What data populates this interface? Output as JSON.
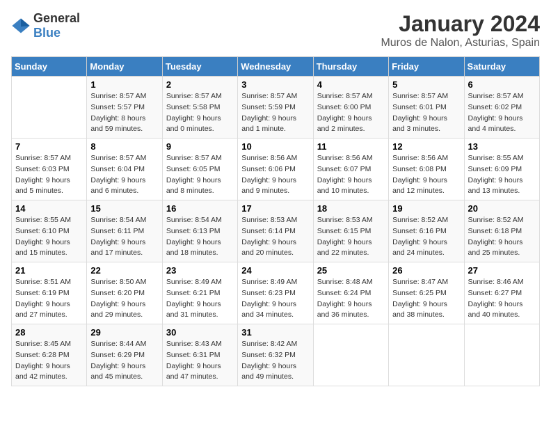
{
  "header": {
    "logo": {
      "general": "General",
      "blue": "Blue"
    },
    "title": "January 2024",
    "subtitle": "Muros de Nalon, Asturias, Spain"
  },
  "calendar": {
    "days_of_week": [
      "Sunday",
      "Monday",
      "Tuesday",
      "Wednesday",
      "Thursday",
      "Friday",
      "Saturday"
    ],
    "weeks": [
      [
        {
          "day": "",
          "sunrise": "",
          "sunset": "",
          "daylight": ""
        },
        {
          "day": "1",
          "sunrise": "Sunrise: 8:57 AM",
          "sunset": "Sunset: 5:57 PM",
          "daylight": "Daylight: 8 hours and 59 minutes."
        },
        {
          "day": "2",
          "sunrise": "Sunrise: 8:57 AM",
          "sunset": "Sunset: 5:58 PM",
          "daylight": "Daylight: 9 hours and 0 minutes."
        },
        {
          "day": "3",
          "sunrise": "Sunrise: 8:57 AM",
          "sunset": "Sunset: 5:59 PM",
          "daylight": "Daylight: 9 hours and 1 minute."
        },
        {
          "day": "4",
          "sunrise": "Sunrise: 8:57 AM",
          "sunset": "Sunset: 6:00 PM",
          "daylight": "Daylight: 9 hours and 2 minutes."
        },
        {
          "day": "5",
          "sunrise": "Sunrise: 8:57 AM",
          "sunset": "Sunset: 6:01 PM",
          "daylight": "Daylight: 9 hours and 3 minutes."
        },
        {
          "day": "6",
          "sunrise": "Sunrise: 8:57 AM",
          "sunset": "Sunset: 6:02 PM",
          "daylight": "Daylight: 9 hours and 4 minutes."
        }
      ],
      [
        {
          "day": "7",
          "sunrise": "Sunrise: 8:57 AM",
          "sunset": "Sunset: 6:03 PM",
          "daylight": "Daylight: 9 hours and 5 minutes."
        },
        {
          "day": "8",
          "sunrise": "Sunrise: 8:57 AM",
          "sunset": "Sunset: 6:04 PM",
          "daylight": "Daylight: 9 hours and 6 minutes."
        },
        {
          "day": "9",
          "sunrise": "Sunrise: 8:57 AM",
          "sunset": "Sunset: 6:05 PM",
          "daylight": "Daylight: 9 hours and 8 minutes."
        },
        {
          "day": "10",
          "sunrise": "Sunrise: 8:56 AM",
          "sunset": "Sunset: 6:06 PM",
          "daylight": "Daylight: 9 hours and 9 minutes."
        },
        {
          "day": "11",
          "sunrise": "Sunrise: 8:56 AM",
          "sunset": "Sunset: 6:07 PM",
          "daylight": "Daylight: 9 hours and 10 minutes."
        },
        {
          "day": "12",
          "sunrise": "Sunrise: 8:56 AM",
          "sunset": "Sunset: 6:08 PM",
          "daylight": "Daylight: 9 hours and 12 minutes."
        },
        {
          "day": "13",
          "sunrise": "Sunrise: 8:55 AM",
          "sunset": "Sunset: 6:09 PM",
          "daylight": "Daylight: 9 hours and 13 minutes."
        }
      ],
      [
        {
          "day": "14",
          "sunrise": "Sunrise: 8:55 AM",
          "sunset": "Sunset: 6:10 PM",
          "daylight": "Daylight: 9 hours and 15 minutes."
        },
        {
          "day": "15",
          "sunrise": "Sunrise: 8:54 AM",
          "sunset": "Sunset: 6:11 PM",
          "daylight": "Daylight: 9 hours and 17 minutes."
        },
        {
          "day": "16",
          "sunrise": "Sunrise: 8:54 AM",
          "sunset": "Sunset: 6:13 PM",
          "daylight": "Daylight: 9 hours and 18 minutes."
        },
        {
          "day": "17",
          "sunrise": "Sunrise: 8:53 AM",
          "sunset": "Sunset: 6:14 PM",
          "daylight": "Daylight: 9 hours and 20 minutes."
        },
        {
          "day": "18",
          "sunrise": "Sunrise: 8:53 AM",
          "sunset": "Sunset: 6:15 PM",
          "daylight": "Daylight: 9 hours and 22 minutes."
        },
        {
          "day": "19",
          "sunrise": "Sunrise: 8:52 AM",
          "sunset": "Sunset: 6:16 PM",
          "daylight": "Daylight: 9 hours and 24 minutes."
        },
        {
          "day": "20",
          "sunrise": "Sunrise: 8:52 AM",
          "sunset": "Sunset: 6:18 PM",
          "daylight": "Daylight: 9 hours and 25 minutes."
        }
      ],
      [
        {
          "day": "21",
          "sunrise": "Sunrise: 8:51 AM",
          "sunset": "Sunset: 6:19 PM",
          "daylight": "Daylight: 9 hours and 27 minutes."
        },
        {
          "day": "22",
          "sunrise": "Sunrise: 8:50 AM",
          "sunset": "Sunset: 6:20 PM",
          "daylight": "Daylight: 9 hours and 29 minutes."
        },
        {
          "day": "23",
          "sunrise": "Sunrise: 8:49 AM",
          "sunset": "Sunset: 6:21 PM",
          "daylight": "Daylight: 9 hours and 31 minutes."
        },
        {
          "day": "24",
          "sunrise": "Sunrise: 8:49 AM",
          "sunset": "Sunset: 6:23 PM",
          "daylight": "Daylight: 9 hours and 34 minutes."
        },
        {
          "day": "25",
          "sunrise": "Sunrise: 8:48 AM",
          "sunset": "Sunset: 6:24 PM",
          "daylight": "Daylight: 9 hours and 36 minutes."
        },
        {
          "day": "26",
          "sunrise": "Sunrise: 8:47 AM",
          "sunset": "Sunset: 6:25 PM",
          "daylight": "Daylight: 9 hours and 38 minutes."
        },
        {
          "day": "27",
          "sunrise": "Sunrise: 8:46 AM",
          "sunset": "Sunset: 6:27 PM",
          "daylight": "Daylight: 9 hours and 40 minutes."
        }
      ],
      [
        {
          "day": "28",
          "sunrise": "Sunrise: 8:45 AM",
          "sunset": "Sunset: 6:28 PM",
          "daylight": "Daylight: 9 hours and 42 minutes."
        },
        {
          "day": "29",
          "sunrise": "Sunrise: 8:44 AM",
          "sunset": "Sunset: 6:29 PM",
          "daylight": "Daylight: 9 hours and 45 minutes."
        },
        {
          "day": "30",
          "sunrise": "Sunrise: 8:43 AM",
          "sunset": "Sunset: 6:31 PM",
          "daylight": "Daylight: 9 hours and 47 minutes."
        },
        {
          "day": "31",
          "sunrise": "Sunrise: 8:42 AM",
          "sunset": "Sunset: 6:32 PM",
          "daylight": "Daylight: 9 hours and 49 minutes."
        },
        {
          "day": "",
          "sunrise": "",
          "sunset": "",
          "daylight": ""
        },
        {
          "day": "",
          "sunrise": "",
          "sunset": "",
          "daylight": ""
        },
        {
          "day": "",
          "sunrise": "",
          "sunset": "",
          "daylight": ""
        }
      ]
    ]
  }
}
